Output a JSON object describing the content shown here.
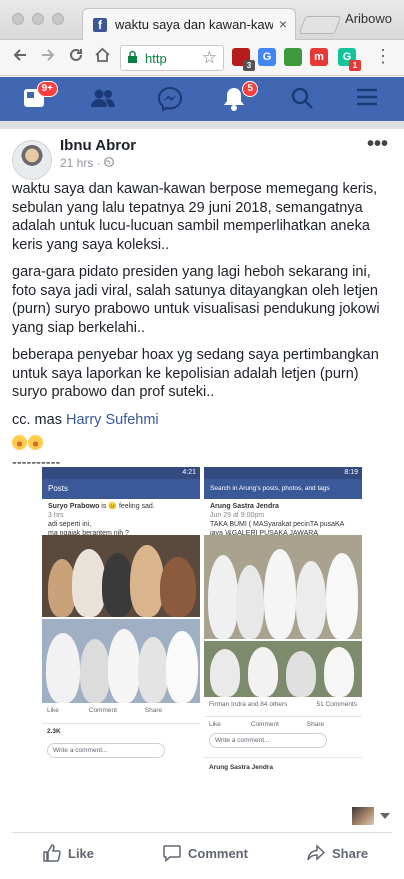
{
  "browser": {
    "tab_title": "waktu saya dan kawan-kawan",
    "tab_close": "×",
    "tab_favicon": "f",
    "profile_name": "Aribowo",
    "url_text": "http",
    "extensions": [
      {
        "icon": "ublock-icon",
        "label": "",
        "badge": "3",
        "color": "#b71c1c"
      },
      {
        "icon": "translate-icon",
        "label": "G",
        "badge": "",
        "color": "#4285f4"
      },
      {
        "icon": "download-icon",
        "label": "",
        "badge": "",
        "color": "#3c9a3c"
      },
      {
        "icon": "m-icon",
        "label": "m",
        "badge": "",
        "color": "#e53935"
      },
      {
        "icon": "grammarly-icon",
        "label": "G",
        "badge": "1",
        "color": "#15c39a"
      }
    ]
  },
  "fb_nav": {
    "home_badge": "9+",
    "notifications_badge": "5"
  },
  "post": {
    "author": "Ibnu Abror",
    "time": "21 hrs",
    "paragraphs": [
      "waktu saya dan kawan-kawan berpose memegang keris, sebulan yang lalu tepatnya 29 juni 2018, semangatnya adalah untuk lucu-lucuan sambil memperlihatkan aneka keris yang saya koleksi..",
      "gara-gara pidato presiden yang lagi heboh sekarang ini, foto saya jadi viral, salah satunya ditayangkan oleh letjen (purn) suryo prabowo untuk visualisasi pendukung jokowi yang siap berkelahi..",
      "beberapa penyebar hoax yg sedang saya pertimbangkan untuk saya laporkan ke kepolisian adalah letjen (purn) suryo prabowo dan prof suteki.."
    ],
    "cc_prefix": "cc. mas ",
    "cc_link": "Harry Sufehmi",
    "divider": "----------"
  },
  "screenshot_left": {
    "status": "4:21",
    "header": "Posts",
    "poster": "Suryo Prabowo",
    "feeling": "is 😐 feeling sad.",
    "time": "3 hrs",
    "line1": "adi seperti ini,",
    "line2": "ma ngajak berantem nih ?",
    "like": "Like",
    "comment": "Comment",
    "share": "Share",
    "reactions": "2.3K",
    "write": "Write a comment..."
  },
  "screenshot_right": {
    "status": "8:19",
    "search": "Search in Arung's posts, photos, and tags",
    "poster": "Arung Sastra Jendra",
    "time": "Jun 29 at 9:00pm",
    "line1": "TAKA BUMI ( MASyarakat pecinTA pusaKA",
    "line2": "jaya )&GALERI PUSAKA JAWARA",
    "tagged": "Firman Indra and 84 others",
    "comments": "51 Comments",
    "like": "Like",
    "comment": "Comment",
    "share": "Share",
    "write": "Write a comment...",
    "poster2": "Arung Sastra Jendra"
  },
  "actions": {
    "like": "Like",
    "comment": "Comment",
    "share": "Share"
  }
}
